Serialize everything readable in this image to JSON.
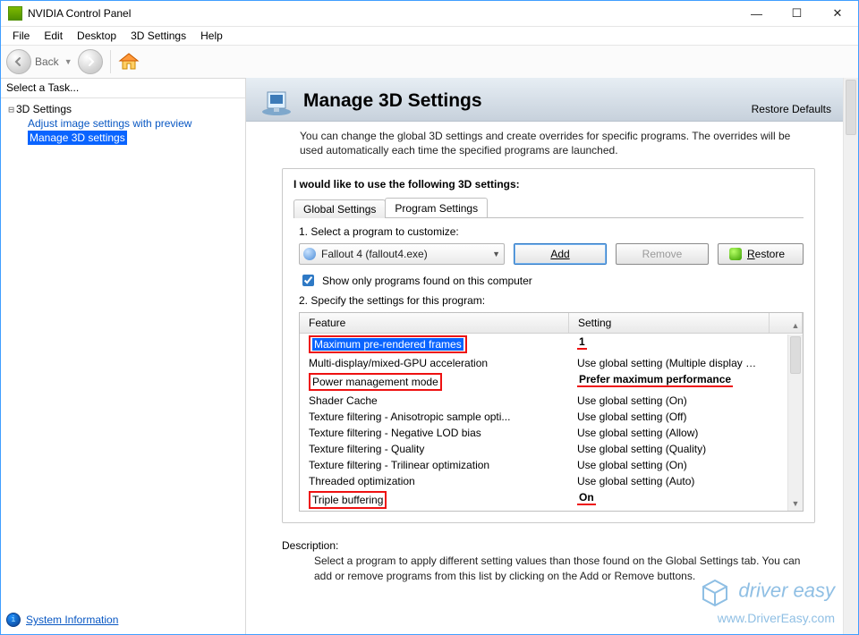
{
  "window": {
    "title": "NVIDIA Control Panel"
  },
  "winbuttons": {
    "min": "—",
    "max": "☐",
    "close": "✕"
  },
  "menu": {
    "items": [
      "File",
      "Edit",
      "Desktop",
      "3D Settings",
      "Help"
    ]
  },
  "toolbar": {
    "back_label": "Back"
  },
  "left": {
    "select_task": "Select a Task...",
    "root": "3D Settings",
    "items": [
      {
        "label": "Adjust image settings with preview",
        "selected": false
      },
      {
        "label": "Manage 3D settings",
        "selected": true
      }
    ],
    "sys_info": "System Information"
  },
  "header": {
    "title": "Manage 3D Settings",
    "restore": "Restore Defaults"
  },
  "intro": "You can change the global 3D settings and create overrides for specific programs. The overrides will be used automatically each time the specified programs are launched.",
  "panel": {
    "lead": "I would like to use the following 3D settings:",
    "tabs": {
      "global": "Global Settings",
      "program": "Program Settings"
    },
    "step1": "1. Select a program to customize:",
    "program": "Fallout 4 (fallout4.exe)",
    "add": "Add",
    "remove": "Remove",
    "restore": "Restore",
    "show_only": "Show only programs found on this computer",
    "step2": "2. Specify the settings for this program:",
    "col_feature": "Feature",
    "col_setting": "Setting",
    "rows": [
      {
        "feature": "Maximum pre-rendered frames",
        "setting": "1",
        "sel": true,
        "f_box": true,
        "s_uline": true
      },
      {
        "feature": "Multi-display/mixed-GPU acceleration",
        "setting": "Use global setting (Multiple display perfor..."
      },
      {
        "feature": "Power management mode",
        "setting": "Prefer maximum performance",
        "f_box": true,
        "s_uline": true
      },
      {
        "feature": "Shader Cache",
        "setting": "Use global setting (On)"
      },
      {
        "feature": "Texture filtering - Anisotropic sample opti...",
        "setting": "Use global setting (Off)"
      },
      {
        "feature": "Texture filtering - Negative LOD bias",
        "setting": "Use global setting (Allow)"
      },
      {
        "feature": "Texture filtering - Quality",
        "setting": "Use global setting (Quality)"
      },
      {
        "feature": "Texture filtering - Trilinear optimization",
        "setting": "Use global setting (On)"
      },
      {
        "feature": "Threaded optimization",
        "setting": "Use global setting (Auto)"
      },
      {
        "feature": "Triple buffering",
        "setting": "On",
        "f_box": true,
        "s_uline": true
      }
    ]
  },
  "description": {
    "h": "Description:",
    "t": "Select a program to apply different setting values than those found on the Global Settings tab. You can add or remove programs from this list by clicking on the Add or Remove buttons."
  },
  "watermark": {
    "line1": "driver easy",
    "line2": "www.DriverEasy.com"
  }
}
